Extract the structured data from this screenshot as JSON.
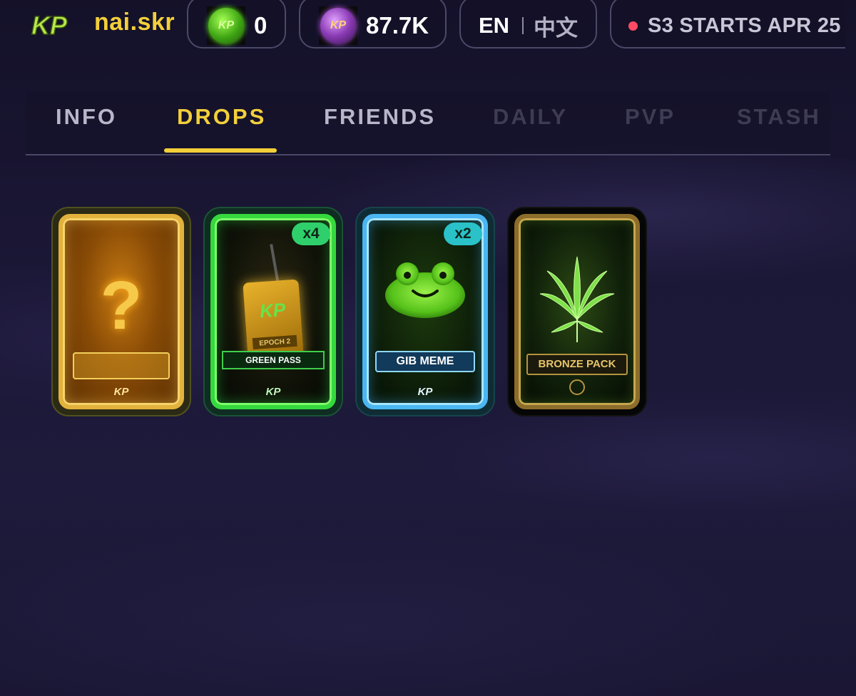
{
  "header": {
    "logo_text": "KP",
    "username": "nai.skr",
    "green_token": {
      "icon": "kp-green-coin-icon",
      "value": "0"
    },
    "purple_token": {
      "icon": "kp-purple-coin-icon",
      "value": "87.7K"
    },
    "language": {
      "en": "EN",
      "zh": "中文"
    },
    "season_banner": "S3 STARTS APR 25"
  },
  "tabs": [
    {
      "label": "INFO",
      "state": "normal"
    },
    {
      "label": "DROPS",
      "state": "active"
    },
    {
      "label": "FRIENDS",
      "state": "normal"
    },
    {
      "label": "DAILY",
      "state": "disabled"
    },
    {
      "label": "PVP",
      "state": "disabled"
    },
    {
      "label": "STASH",
      "state": "disabled"
    }
  ],
  "cards": [
    {
      "name": "mystery-card",
      "symbol": "?",
      "brand": "KP",
      "count": ""
    },
    {
      "name": "green-pass-card",
      "label": "GREEN PASS",
      "tag_text": "EPOCH 2",
      "tag_brand": "KP",
      "brand": "KP",
      "count": "x4"
    },
    {
      "name": "gib-meme-card",
      "label": "GIB MEME",
      "brand": "KP",
      "count": "x2"
    },
    {
      "name": "bronze-pack-card",
      "label": "BRONZE PACK",
      "count": ""
    }
  ],
  "colors": {
    "accent_gold": "#f3cf3a",
    "tab_inactive": "#b8b6c8",
    "tab_disabled": "#3e3b54",
    "badge_green": "#2fd06c",
    "badge_teal": "#2ac1c9",
    "live_dot": "#ff4a64"
  }
}
